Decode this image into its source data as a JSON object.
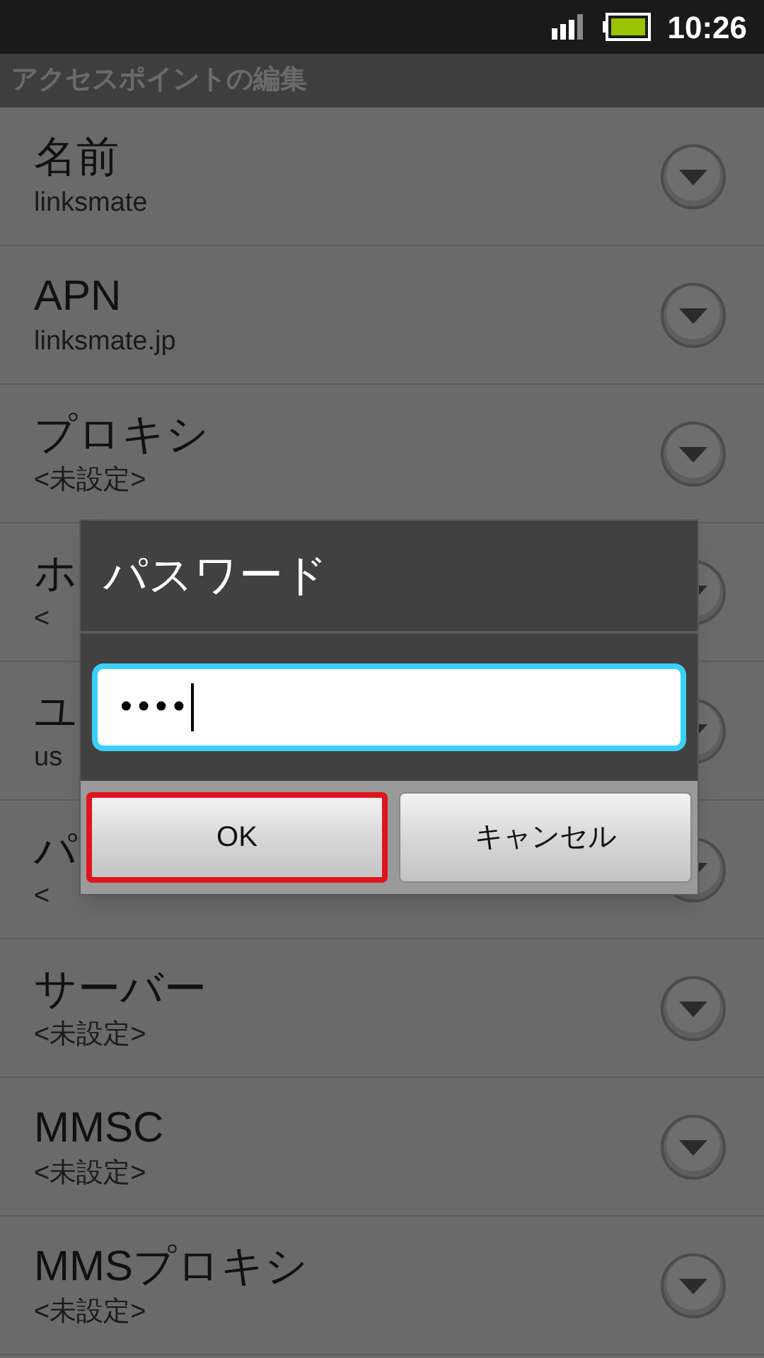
{
  "status_bar": {
    "time": "10:26"
  },
  "title": "アクセスポイントの編集",
  "settings": [
    {
      "title": "名前",
      "summary": "linksmate"
    },
    {
      "title": "APN",
      "summary": "linksmate.jp"
    },
    {
      "title": "プロキシ",
      "summary": "<未設定>"
    },
    {
      "title": "ホ",
      "summary": "<"
    },
    {
      "title": "ユ",
      "summary": "us"
    },
    {
      "title": "パ",
      "summary": "<"
    },
    {
      "title": "サーバー",
      "summary": "<未設定>"
    },
    {
      "title": "MMSC",
      "summary": "<未設定>"
    },
    {
      "title": "MMSプロキシ",
      "summary": "<未設定>"
    }
  ],
  "dialog": {
    "title": "パスワード",
    "field": {
      "value": "••••"
    },
    "buttons": [
      {
        "label": "OK",
        "focused": true
      },
      {
        "label": "キャンセル",
        "focused": false
      }
    ]
  }
}
